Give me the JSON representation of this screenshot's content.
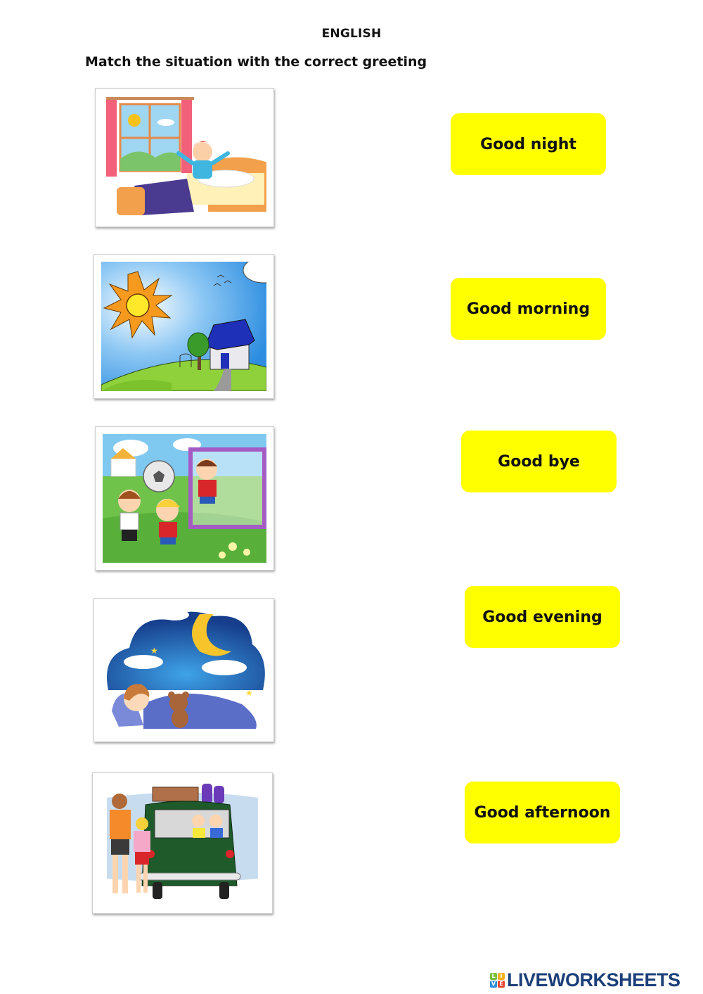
{
  "header": {
    "title": "ENGLISH",
    "instruction": "Match the situation with the correct greeting"
  },
  "pictures": [
    {
      "scene": "child waking up in bed, morning sun through window"
    },
    {
      "scene": "bright sun over house on green hill"
    },
    {
      "scene": "children playing football in the park"
    },
    {
      "scene": "girl sleeping with teddy bear under moon and stars"
    },
    {
      "scene": "family waving goodbye to car leaving"
    }
  ],
  "greetings": [
    {
      "label": "Good night"
    },
    {
      "label": "Good morning"
    },
    {
      "label": "Good bye"
    },
    {
      "label": "Good evening"
    },
    {
      "label": "Good afternoon"
    }
  ],
  "colors": {
    "greeting_box": "#ffff00",
    "logo_text": "#1c3f7a"
  },
  "footer": {
    "logo_text": "LIVEWORKSHEETS",
    "logo_tiles": [
      {
        "letter": "L",
        "color": "#7bbf3a"
      },
      {
        "letter": "I",
        "color": "#f2b01e"
      },
      {
        "letter": "V",
        "color": "#2f8fd8"
      },
      {
        "letter": "E",
        "color": "#e8432e"
      }
    ]
  }
}
